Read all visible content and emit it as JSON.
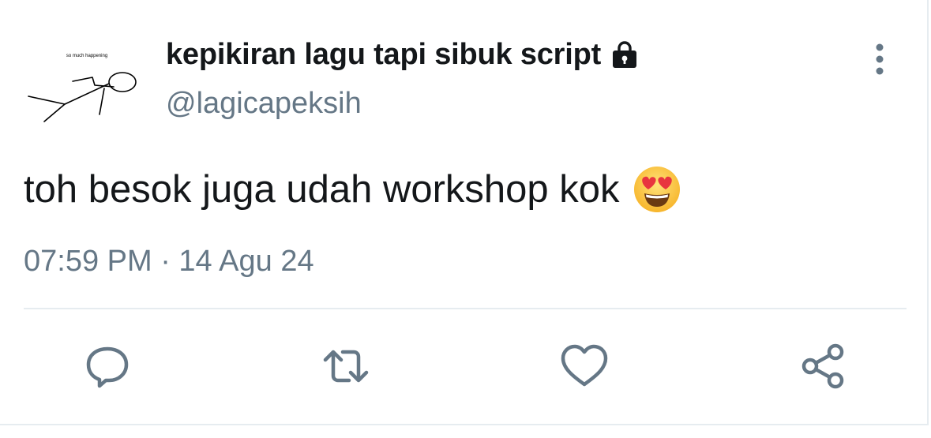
{
  "tweet": {
    "avatar": {
      "caption": "so much happening",
      "icon": "stick-figure-avatar"
    },
    "author": {
      "display_name": "kepikiran lagu tapi sibuk script",
      "protected_icon": "lock-icon",
      "handle": "@lagicapeksih"
    },
    "menu_icon": "more-vertical-icon",
    "text": "toh besok juga udah workshop kok",
    "emoji": "heart-eyes-emoji",
    "timestamp": "07:59 PM · 14 Agu 24",
    "actions": [
      {
        "name": "reply",
        "icon": "reply-icon"
      },
      {
        "name": "retweet",
        "icon": "retweet-icon"
      },
      {
        "name": "like",
        "icon": "heart-icon"
      },
      {
        "name": "share",
        "icon": "share-icon"
      }
    ],
    "colors": {
      "primary_text": "#14171a",
      "secondary_text": "#657786",
      "divider": "#e6ecf0"
    }
  }
}
